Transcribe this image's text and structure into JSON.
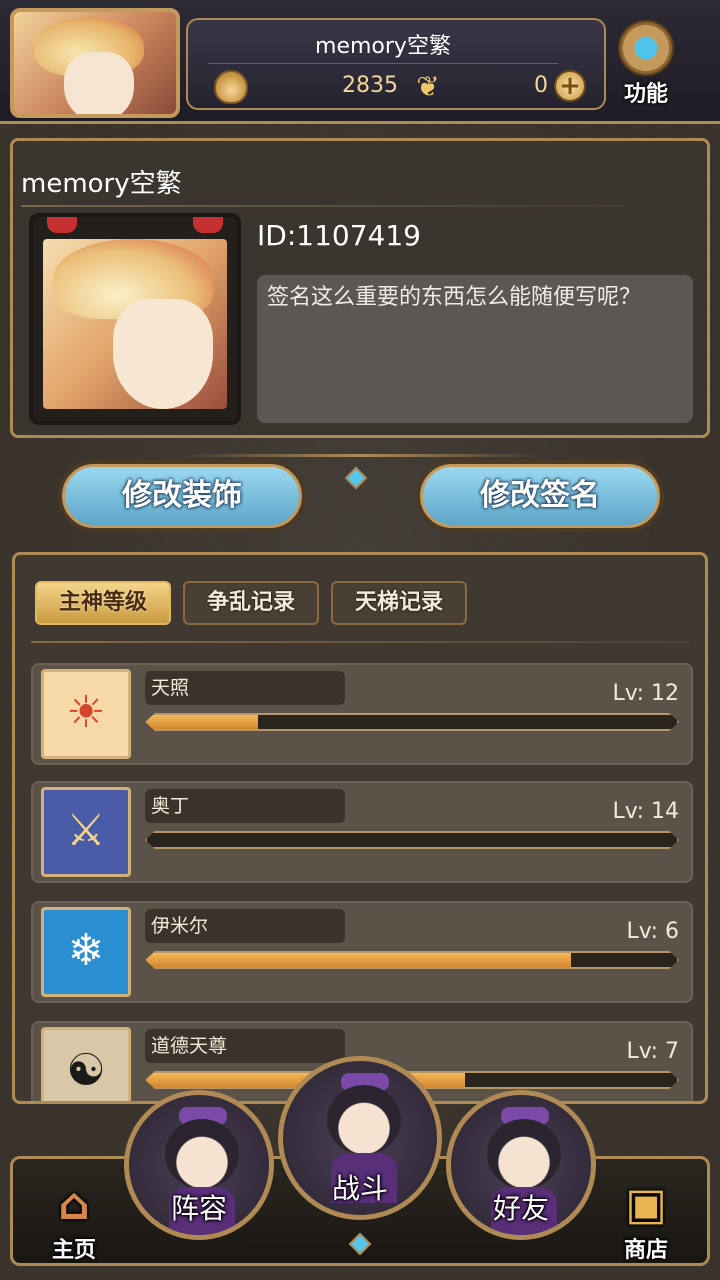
{
  "header": {
    "player_name": "memory空繁",
    "gold": "2835",
    "gems": "0",
    "function_label": "功能",
    "icons": {
      "currency_icon": "flame-coin-icon",
      "butterfly_icon": "butterfly-icon",
      "add_icon": "plus-icon",
      "function_icon": "gear-icon"
    }
  },
  "profile": {
    "name": "memory空繁",
    "id": "ID:1107419",
    "signature": "签名这么重要的东西怎么能随便写呢？"
  },
  "actions": {
    "edit_decoration": "修改装饰",
    "edit_signature": "修改签名"
  },
  "tabs": [
    {
      "label": "主神等级",
      "active": true
    },
    {
      "label": "争乱记录",
      "active": false
    },
    {
      "label": "天梯记录",
      "active": false
    }
  ],
  "gods": [
    {
      "name": "天照",
      "level": "Lv: 12",
      "progress": 0.21,
      "icon": "sun-icon",
      "icon_bg": "#f6d9a6",
      "icon_color": "#d2452c",
      "glyph": "☀"
    },
    {
      "name": "奥丁",
      "level": "Lv: 14",
      "progress": 0.0,
      "icon": "winged-sword-icon",
      "icon_bg": "#4a5ba8",
      "icon_color": "#f2d58a",
      "glyph": "⚔"
    },
    {
      "name": "伊米尔",
      "level": "Lv: 6",
      "progress": 0.8,
      "icon": "frost-beast-icon",
      "icon_bg": "#2a8fd0",
      "icon_color": "#ffffff",
      "glyph": "❄"
    },
    {
      "name": "道德天尊",
      "level": "Lv: 7",
      "progress": 0.6,
      "icon": "yin-yang-icon",
      "icon_bg": "#d8c8a8",
      "icon_color": "#1a1a1a",
      "glyph": "☯"
    }
  ],
  "nav": {
    "home": "主页",
    "team": "阵容",
    "battle": "战斗",
    "friends": "好友",
    "shop": "商店",
    "icons": {
      "home": "house-icon",
      "shop": "treasure-chest-icon"
    }
  },
  "colors": {
    "accent_gold": "#b08a55",
    "button_blue": "#7ec1e0",
    "bar_orange": "#e6a040"
  }
}
